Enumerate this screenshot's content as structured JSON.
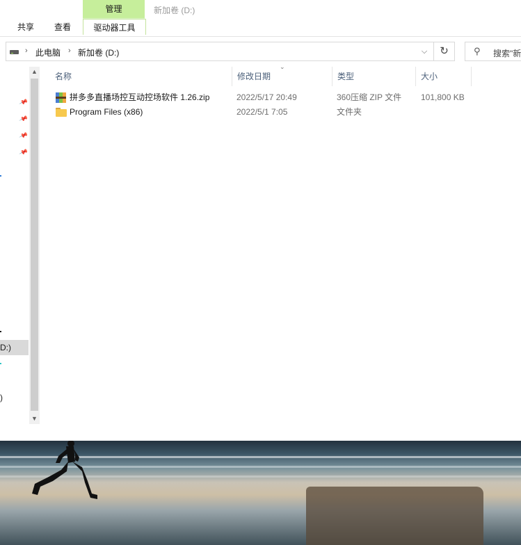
{
  "ribbon": {
    "context_group": "管理",
    "window_title": "新加卷 (D:)",
    "tabs": [
      "共享",
      "查看",
      "驱动器工具"
    ]
  },
  "address": {
    "crumbs": [
      "此电脑",
      "新加卷 (D:)"
    ],
    "dropdown_icon": "chevron-down-icon",
    "refresh_icon": "refresh-icon"
  },
  "search": {
    "placeholder": "搜索\"新"
  },
  "nav": {
    "selected_fragment": "D:)",
    "fragments": [
      ")"
    ]
  },
  "columns": [
    "名称",
    "修改日期",
    "类型",
    "大小"
  ],
  "files": [
    {
      "name": "拼多多直播场控互动控场软件 1.26.zip",
      "date": "2022/5/17 20:49",
      "type": "360压缩 ZIP 文件",
      "size": "101,800 KB",
      "icon": "zip-archive-icon"
    },
    {
      "name": "Program Files (x86)",
      "date": "2022/5/1 7:05",
      "type": "文件夹",
      "size": "",
      "icon": "folder-icon"
    }
  ],
  "colors": {
    "context_tab": "#c6ee9b",
    "context_group_bg": "#dff5c9",
    "header_text": "#4c607a",
    "selection": "#d9d9d9"
  }
}
